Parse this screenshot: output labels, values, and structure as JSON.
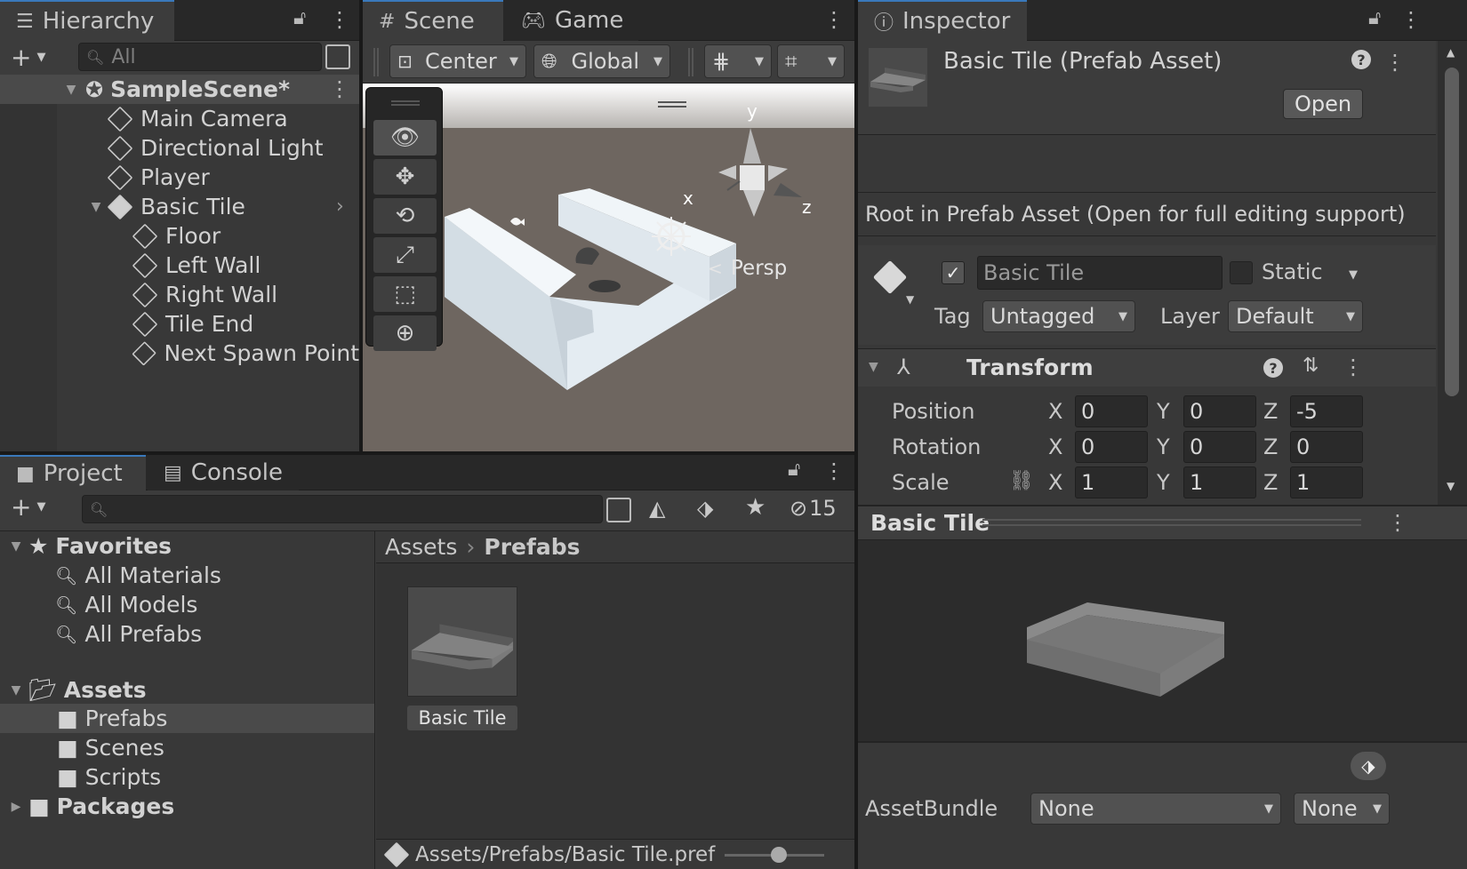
{
  "hierarchy": {
    "tab_label": "Hierarchy",
    "search_placeholder": "All",
    "scene_name": "SampleScene*",
    "items": [
      {
        "label": "Main Camera"
      },
      {
        "label": "Directional Light"
      },
      {
        "label": "Player"
      },
      {
        "label": "Basic Tile"
      },
      {
        "label": "Floor"
      },
      {
        "label": "Left Wall"
      },
      {
        "label": "Right Wall"
      },
      {
        "label": "Tile End"
      },
      {
        "label": "Next Spawn Point"
      }
    ]
  },
  "scene": {
    "tabs": [
      {
        "label": "Scene"
      },
      {
        "label": "Game"
      }
    ],
    "pivot_label": "Center",
    "space_label": "Global",
    "gizmo": {
      "x": "x",
      "y": "y",
      "z": "z",
      "projection": "Persp"
    }
  },
  "inspector": {
    "tab_label": "Inspector",
    "asset_title": "Basic Tile (Prefab Asset)",
    "open_label": "Open",
    "notice": "Root in Prefab Asset (Open for full editing support)",
    "object_name": "Basic Tile",
    "static_label": "Static",
    "tag_label": "Tag",
    "tag_value": "Untagged",
    "layer_label": "Layer",
    "layer_value": "Default",
    "transform": {
      "title": "Transform",
      "position_label": "Position",
      "rotation_label": "Rotation",
      "scale_label": "Scale",
      "position": {
        "x": "0",
        "y": "0",
        "z": "-5"
      },
      "rotation": {
        "x": "0",
        "y": "0",
        "z": "0"
      },
      "scale": {
        "x": "1",
        "y": "1",
        "z": "1"
      }
    },
    "preview_title": "Basic Tile",
    "assetbundle_label": "AssetBundle",
    "assetbundle_value": "None",
    "assetbundle_variant": "None"
  },
  "project": {
    "tabs": [
      {
        "label": "Project"
      },
      {
        "label": "Console"
      }
    ],
    "hidden_count": "15",
    "favorites_label": "Favorites",
    "favorites": [
      {
        "label": "All Materials"
      },
      {
        "label": "All Models"
      },
      {
        "label": "All Prefabs"
      }
    ],
    "assets_label": "Assets",
    "folders": [
      {
        "label": "Prefabs"
      },
      {
        "label": "Scenes"
      },
      {
        "label": "Scripts"
      }
    ],
    "packages_label": "Packages",
    "breadcrumb": {
      "root": "Assets",
      "current": "Prefabs"
    },
    "asset_item": "Basic Tile",
    "footer_path": "Assets/Prefabs/Basic Tile.pref"
  },
  "colors": {
    "accent": "#3a79bb",
    "panel": "#383838",
    "background": "#191919"
  }
}
